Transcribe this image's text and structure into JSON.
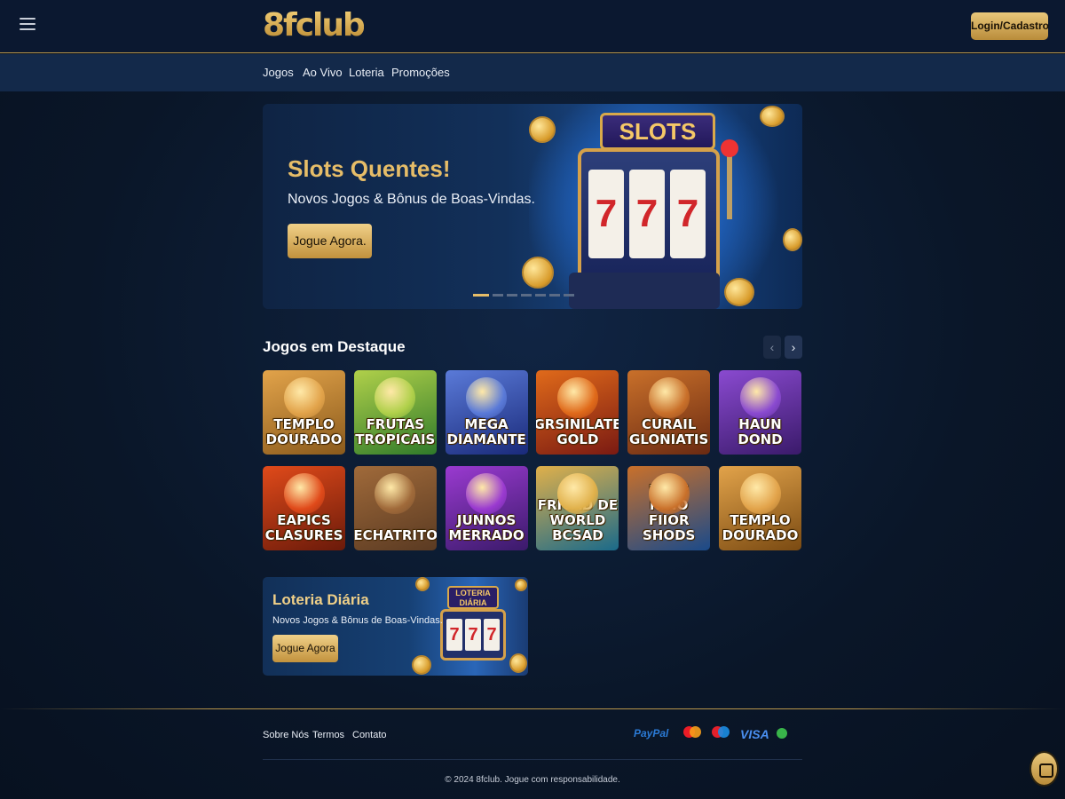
{
  "header": {
    "logo": "8fclub",
    "login_label": "Login/Cadastro",
    "menu_icon": "hamburger-icon"
  },
  "nav": {
    "items": [
      "Jogos",
      "Ao Vivo",
      "Loteria",
      "Promoções"
    ]
  },
  "hero": {
    "title": "Slots Quentes!",
    "subtitle": "Novos Jogos & Bônus de Boas-Vindas.",
    "cta": "Jogue Agora.",
    "slot_sign": "SLOTS",
    "reels": [
      "7",
      "7",
      "7"
    ],
    "carousel_total": 7,
    "carousel_active": 1
  },
  "featured": {
    "title": "Jogos em Destaque",
    "prev_icon": "chevron-left-icon",
    "next_icon": "chevron-right-icon",
    "games": [
      {
        "name": "TEMPLO DOURADO"
      },
      {
        "name": "FRUTAS TROPICAIS"
      },
      {
        "name": "MEGA DIAMANTE"
      },
      {
        "name": "GRSINILATE GOLD"
      },
      {
        "name": "CURAIL GLONIATIS"
      },
      {
        "name": "HAUN DOND"
      },
      {
        "name": "EAPICS CLASURES"
      },
      {
        "name": "RECHATRITOS"
      },
      {
        "name": "JUNNOS MERRADO"
      },
      {
        "name": "FRICAD DE WORLD BCSAD"
      },
      {
        "name": "BARF NINO FIIOR SHODS"
      },
      {
        "name": "TEMPLO DOURADO"
      }
    ]
  },
  "lottery": {
    "title": "Loteria Diária",
    "subtitle": "Novos Jogos & Bônus de Boas-Vindas.",
    "cta": "Jogue Agora",
    "sign": "LOTERIA DIÁRIA",
    "reels": [
      "7",
      "7",
      "7"
    ]
  },
  "footer": {
    "links": [
      "Sobre Nós",
      "Termos",
      "Contato"
    ],
    "payments": {
      "paypal": "PayPal",
      "visa": "VISA",
      "mastercard_icon": "mastercard-icon",
      "maestro_icon": "maestro-icon",
      "secure_icon": "secure-badge-icon"
    },
    "copyright": "© 2024 8fclub. Jogue com responsabilidade.",
    "chat_icon": "chat-icon"
  },
  "colors": {
    "gold": "#e6bd68",
    "background": "#0a1628",
    "nav_bar": "#13294a"
  }
}
